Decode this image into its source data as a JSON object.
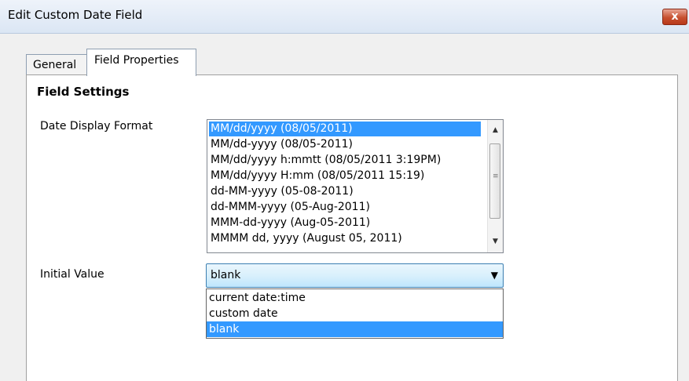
{
  "window": {
    "title": "Edit Custom Date Field",
    "close_label": "x"
  },
  "tabs": [
    {
      "label": "General"
    },
    {
      "label": "Field Properties"
    }
  ],
  "section_title": "Field Settings",
  "date_display_format": {
    "label": "Date Display Format",
    "selected_index": 0,
    "options": [
      "MM/dd/yyyy (08/05/2011)",
      "MM/dd-yyyy (08/05-2011)",
      "MM/dd/yyyy h:mmtt (08/05/2011 3:19PM)",
      "MM/dd/yyyy H:mm (08/05/2011 15:19)",
      "dd-MM-yyyy (05-08-2011)",
      "dd-MMM-yyyy (05-Aug-2011)",
      "MMM-dd-yyyy (Aug-05-2011)",
      "MMMM dd, yyyy (August 05, 2011)"
    ]
  },
  "initial_value": {
    "label": "Initial Value",
    "selected": "blank",
    "options": [
      "current date:time",
      "custom date",
      "blank"
    ]
  },
  "icons": {
    "close": "close-icon",
    "scroll_up": "scroll-up-arrow-icon",
    "scroll_down": "scroll-down-arrow-icon",
    "dropdown": "chevron-down-icon"
  },
  "colors": {
    "selection": "#3399ff",
    "close_button": "#c7502f",
    "title_bar": "#dbe6f4"
  }
}
